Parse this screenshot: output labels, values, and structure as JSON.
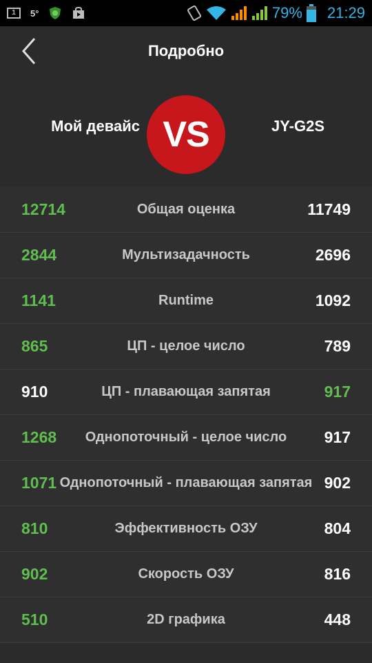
{
  "status_bar": {
    "notification_box": "1",
    "temperature": "5°",
    "battery_percent": "79%",
    "time": "21:29",
    "colors": {
      "accent": "#33b5e5",
      "signal": "#ff8c00",
      "signal2": "#8ac53f"
    }
  },
  "header": {
    "title": "Подробно"
  },
  "versus": {
    "left_device": "Мой девайс",
    "badge": "VS",
    "right_device": "JY-G2S",
    "badge_color": "#c8161d"
  },
  "rows": [
    {
      "left": "12714",
      "label": "Общая оценка",
      "right": "11749",
      "winner": "left"
    },
    {
      "left": "2844",
      "label": "Мультизадачность",
      "right": "2696",
      "winner": "left"
    },
    {
      "left": "1141",
      "label": "Runtime",
      "right": "1092",
      "winner": "left"
    },
    {
      "left": "865",
      "label": "ЦП - целое число",
      "right": "789",
      "winner": "left"
    },
    {
      "left": "910",
      "label": "ЦП - плавающая запятая",
      "right": "917",
      "winner": "right"
    },
    {
      "left": "1268",
      "label": "Однопоточный - целое число",
      "right": "917",
      "winner": "left"
    },
    {
      "left": "1071",
      "label": "Однопоточный - плавающая запятая",
      "right": "902",
      "winner": "left"
    },
    {
      "left": "810",
      "label": "Эффективность ОЗУ",
      "right": "804",
      "winner": "left"
    },
    {
      "left": "902",
      "label": "Скорость ОЗУ",
      "right": "816",
      "winner": "left"
    },
    {
      "left": "510",
      "label": "2D графика",
      "right": "448",
      "winner": "left"
    }
  ],
  "colors": {
    "winner": "#5fbe4f",
    "loser": "#ffffff"
  }
}
